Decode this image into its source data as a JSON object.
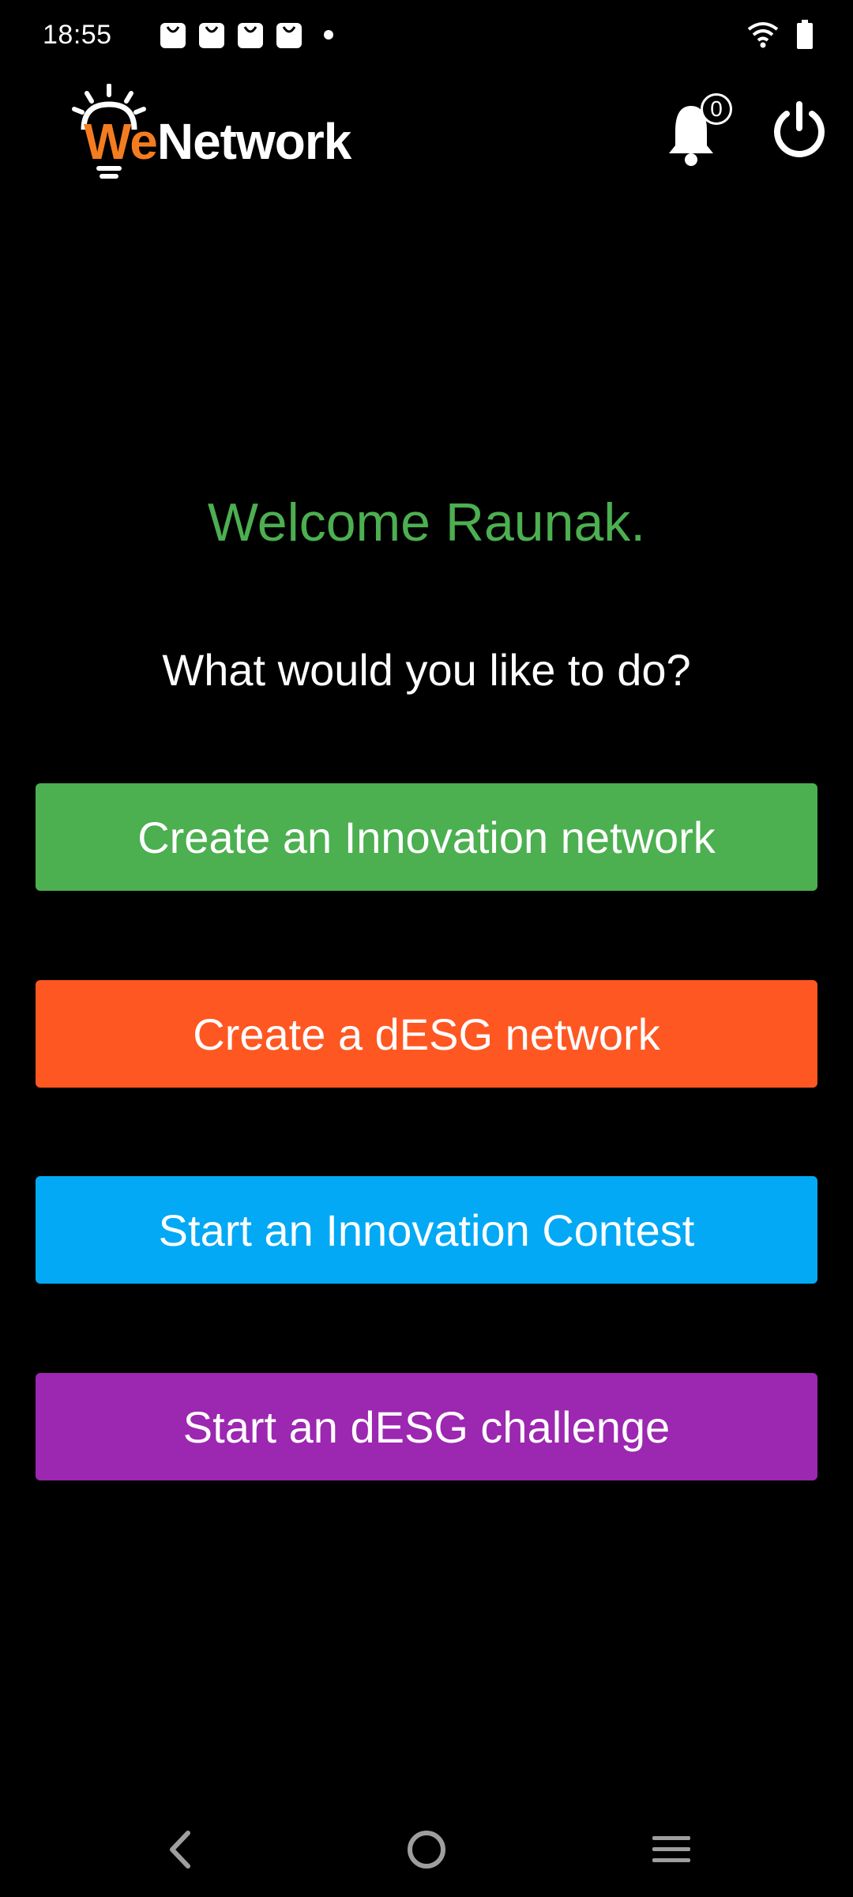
{
  "status_bar": {
    "time": "18:55",
    "notification_icons": [
      "bag-icon",
      "bag-icon",
      "bag-icon",
      "bag-icon"
    ],
    "icons": [
      "wifi-icon",
      "battery-icon"
    ]
  },
  "header": {
    "logo_we": "We",
    "logo_network": "Network",
    "notification_count": "0"
  },
  "main": {
    "welcome": "Welcome Raunak.",
    "prompt": "What would you like to do?",
    "buttons": [
      {
        "label": "Create an Innovation network",
        "color": "#4caf50"
      },
      {
        "label": "Create a dESG network",
        "color": "#ff5722"
      },
      {
        "label": "Start an Innovation Contest",
        "color": "#03a9f4"
      },
      {
        "label": "Start an dESG challenge",
        "color": "#9c27b0"
      }
    ]
  },
  "nav_bar": {
    "icons": [
      "back-icon",
      "home-icon",
      "recents-icon"
    ]
  },
  "colors": {
    "background": "#000000",
    "welcome_text": "#4caf50",
    "logo_accent": "#f47c20"
  }
}
